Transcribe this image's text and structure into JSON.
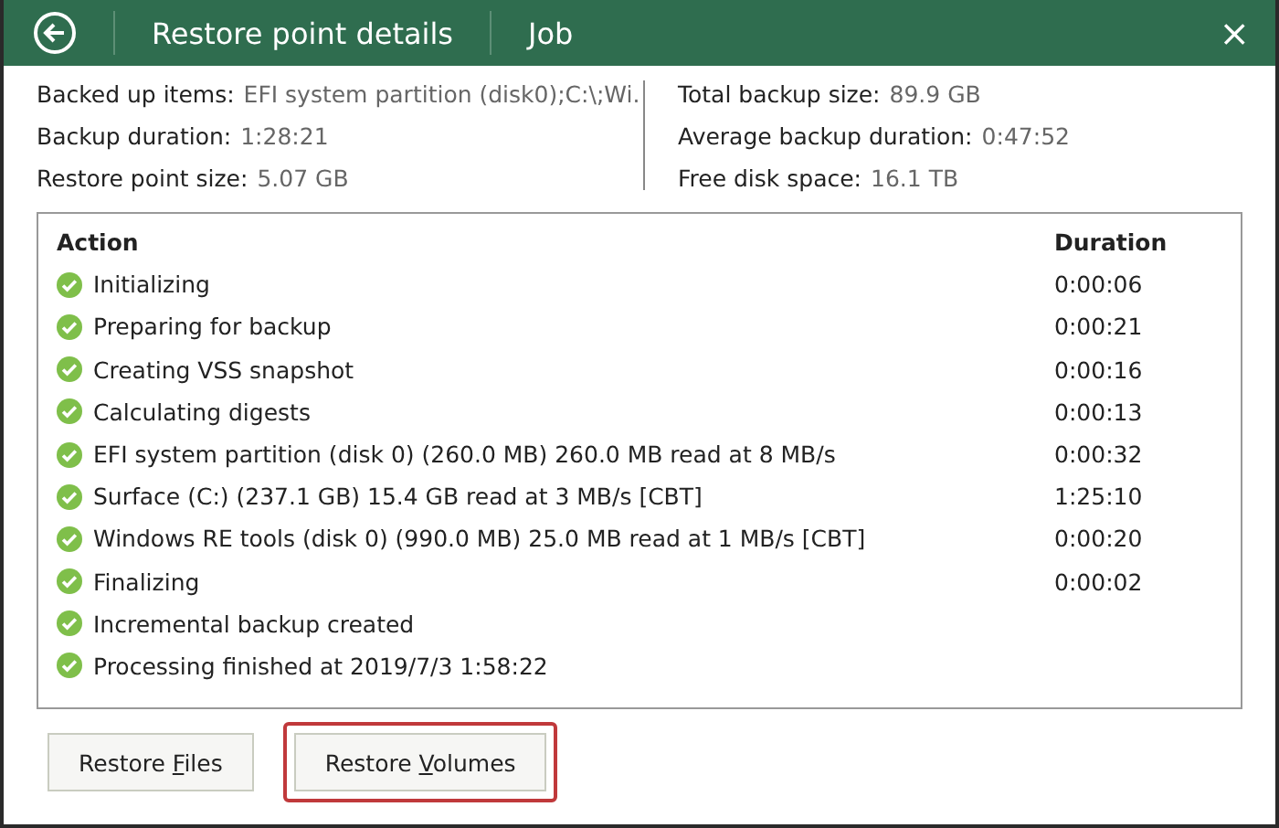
{
  "title_bar": {
    "tabs": [
      "Restore point details",
      "Job"
    ],
    "close": "×"
  },
  "info_left": [
    {
      "label": "Backed up items:",
      "value": "EFI system partition (disk0);C:\\;Wi."
    },
    {
      "label": "Backup duration:",
      "value": "1:28:21"
    },
    {
      "label": "Restore point size:",
      "value": "5.07 GB"
    }
  ],
  "info_right": [
    {
      "label": "Total backup size:",
      "value": "89.9 GB"
    },
    {
      "label": "Average backup duration:",
      "value": "0:47:52"
    },
    {
      "label": "Free disk space:",
      "value": "16.1 TB"
    }
  ],
  "table": {
    "columns": [
      "Action",
      "Duration"
    ],
    "rows": [
      {
        "succeeded": true,
        "action": "Initializing",
        "duration": "0:00:06"
      },
      {
        "succeeded": true,
        "action": "Preparing for backup",
        "duration": "0:00:21"
      },
      {
        "succeeded": true,
        "action": "Creating VSS snapshot",
        "duration": "0:00:16"
      },
      {
        "succeeded": true,
        "action": "Calculating digests",
        "duration": "0:00:13"
      },
      {
        "succeeded": true,
        "action": "EFI system partition (disk 0) (260.0 MB) 260.0 MB read at 8 MB/s",
        "duration": "0:00:32"
      },
      {
        "succeeded": true,
        "action": "Surface (C:) (237.1 GB) 15.4 GB read at 3 MB/s [CBT]",
        "duration": "1:25:10"
      },
      {
        "succeeded": true,
        "action": "Windows RE tools (disk 0) (990.0 MB) 25.0 MB read at 1 MB/s [CBT]",
        "duration": "0:00:20"
      },
      {
        "succeeded": true,
        "action": "Finalizing",
        "duration": "0:00:02"
      },
      {
        "succeeded": true,
        "action": "Incremental backup created"
      },
      {
        "succeeded": true,
        "action": "Processing finished at 2019/7/3 1:58:22"
      }
    ]
  },
  "buttons": [
    {
      "label_before": "Restore ",
      "access_key": "F",
      "label_after": "iles",
      "highlighted": false
    },
    {
      "label_before": "Restore ",
      "access_key": "V",
      "label_after": "olumes",
      "highlighted": true
    }
  ]
}
